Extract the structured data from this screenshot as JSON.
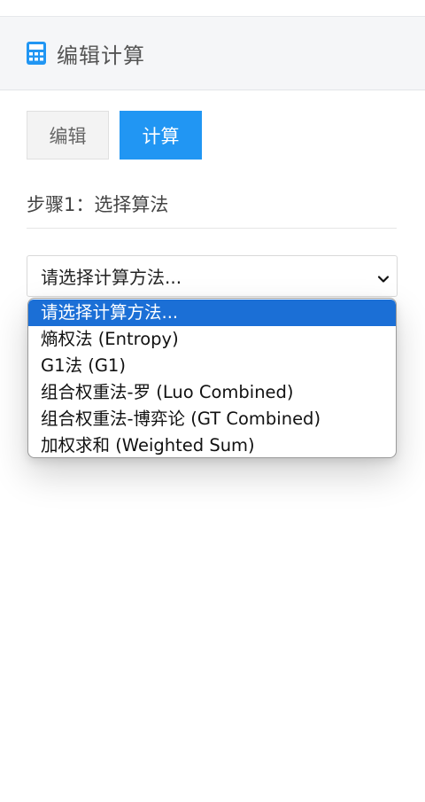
{
  "header": {
    "icon": "calculator-icon",
    "title": "编辑计算"
  },
  "tabs": [
    {
      "label": "编辑",
      "active": false
    },
    {
      "label": "计算",
      "active": true
    }
  ],
  "step": {
    "title": "步骤1：选择算法"
  },
  "algorithm_select": {
    "selected_label": "请选择计算方法...",
    "chevron": "chevron-down-icon",
    "options": [
      {
        "label": "请选择计算方法...",
        "selected": true
      },
      {
        "label": "熵权法 (Entropy)",
        "selected": false
      },
      {
        "label": "G1法 (G1)",
        "selected": false
      },
      {
        "label": "组合权重法-罗 (Luo Combined)",
        "selected": false
      },
      {
        "label": "组合权重法-博弈论 (GT Combined)",
        "selected": false
      },
      {
        "label": "加权求和 (Weighted Sum)",
        "selected": false
      }
    ]
  },
  "colors": {
    "accent": "#2196f3",
    "option_highlight": "#1b6fd6",
    "header_bg": "#f5f6f8"
  }
}
